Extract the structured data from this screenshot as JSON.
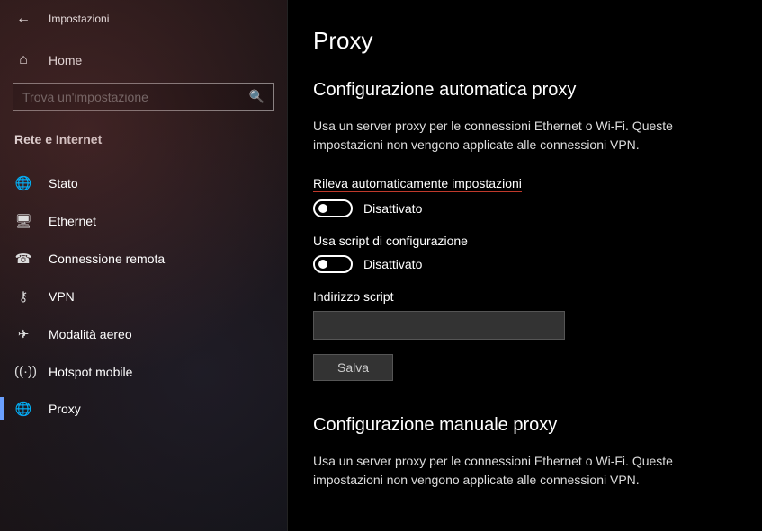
{
  "titlebar": {
    "app_title": "Impostazioni"
  },
  "home": {
    "label": "Home"
  },
  "search": {
    "placeholder": "Trova un'impostazione"
  },
  "category": "Rete e Internet",
  "nav": [
    {
      "icon": "status",
      "label": "Stato"
    },
    {
      "icon": "ethernet",
      "label": "Ethernet"
    },
    {
      "icon": "dialup",
      "label": "Connessione remota"
    },
    {
      "icon": "vpn",
      "label": "VPN"
    },
    {
      "icon": "airplane",
      "label": "Modalità aereo"
    },
    {
      "icon": "hotspot",
      "label": "Hotspot mobile"
    },
    {
      "icon": "proxy",
      "label": "Proxy"
    }
  ],
  "page": {
    "title": "Proxy",
    "auto": {
      "heading": "Configurazione automatica proxy",
      "desc": "Usa un server proxy per le connessioni Ethernet o Wi-Fi. Queste impostazioni non vengono applicate alle connessioni VPN.",
      "detect_label": "Rileva automaticamente impostazioni",
      "detect_state": "Disattivato",
      "script_label": "Usa script di configurazione",
      "script_state": "Disattivato",
      "script_addr_label": "Indirizzo script",
      "script_addr_value": "",
      "save_label": "Salva"
    },
    "manual": {
      "heading": "Configurazione manuale proxy",
      "desc": "Usa un server proxy per le connessioni Ethernet o Wi-Fi. Queste impostazioni non vengono applicate alle connessioni VPN."
    }
  }
}
